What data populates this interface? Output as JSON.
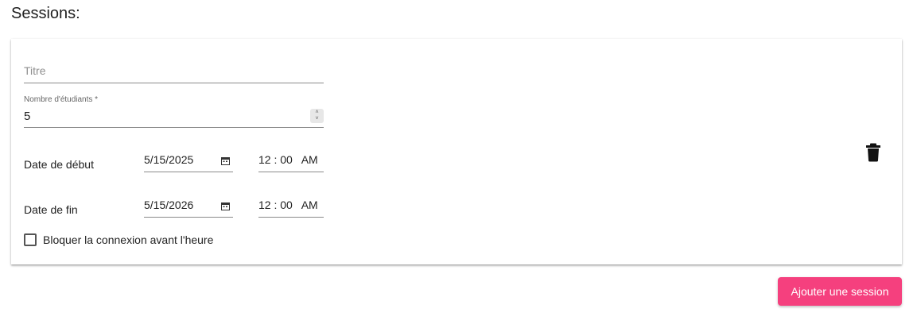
{
  "section": {
    "title": "Sessions:"
  },
  "session": {
    "title_placeholder": "Titre",
    "students_label": "Nombre d'étudiants *",
    "students_value": "5",
    "start_label": "Date de début",
    "start_date": "5/15/2025",
    "start_time": "12 : 00   AM",
    "end_label": "Date de fin",
    "end_date": "5/15/2026",
    "end_time": "12 : 00   AM",
    "block_login_label": "Bloquer la connexion avant l'heure",
    "block_login_checked": false
  },
  "actions": {
    "add_session_label": "Ajouter une session",
    "delete_icon": "trash-icon",
    "calendar_icon": "calendar-icon"
  },
  "colors": {
    "accent": "#f5407e",
    "underline": "#8a8a8a"
  }
}
